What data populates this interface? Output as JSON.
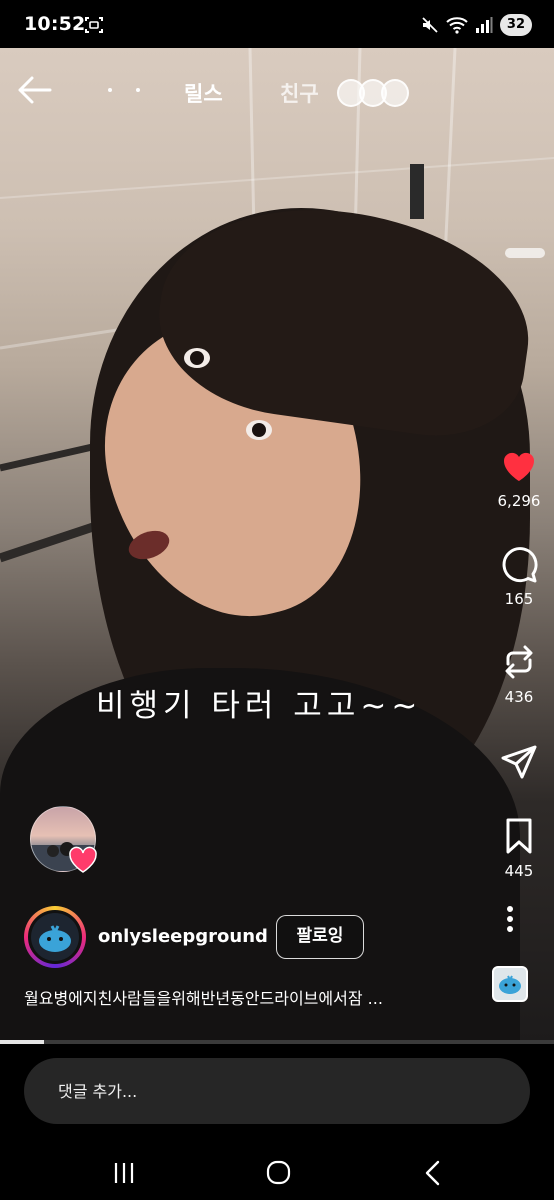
{
  "status_bar": {
    "time": "10:52",
    "battery": "32",
    "icons": [
      "screenshot-icon",
      "mute-icon",
      "wifi-icon",
      "signal-icon"
    ]
  },
  "top_bar": {
    "tab_reels": "릴스",
    "tab_friends": "친구"
  },
  "video": {
    "overlay_text": "비행기 타러 고고~~"
  },
  "actions": {
    "like_count": "6,296",
    "comment_count": "165",
    "repost_count": "436",
    "save_count": "445",
    "liked": true,
    "like_color": "#ff3040"
  },
  "author": {
    "username": "onlysleepground",
    "follow_label": "팔로잉"
  },
  "caption": "월요병에지친사람들을위해반년동안드라이브에서잠 ...",
  "progress": 0.08,
  "comment": {
    "placeholder": "댓글 추가..."
  },
  "colors": {
    "accent_heart": "#ff3040",
    "comment_bg": "#262626"
  }
}
